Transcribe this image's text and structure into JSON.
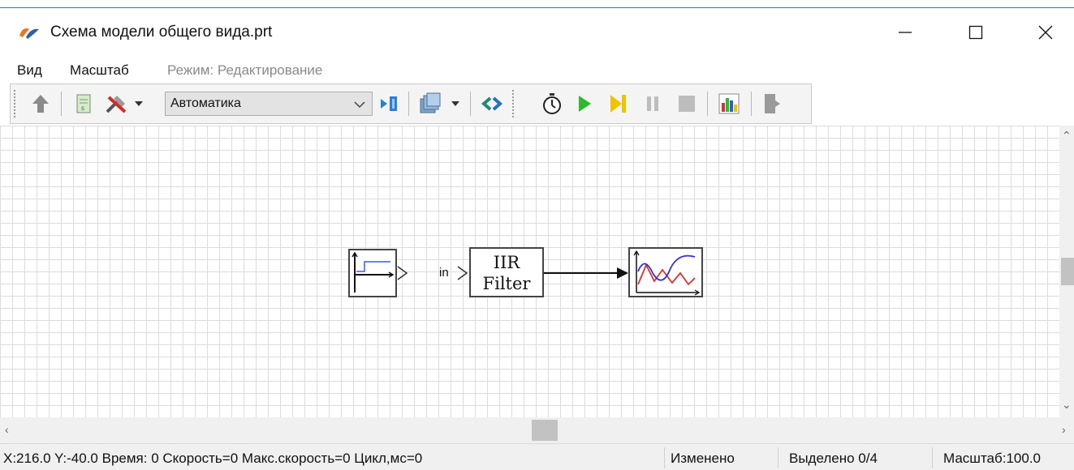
{
  "window": {
    "title": "Схема модели общего вида.prt",
    "icon": "app-logo-icon"
  },
  "menu": {
    "items": [
      "Вид",
      "Масштаб"
    ],
    "mode": "Режим: Редактирование"
  },
  "toolbar": {
    "library_select": "Автоматика",
    "icons": [
      "up-arrow-icon",
      "document-icon",
      "tools-icon",
      "dropdown-icon",
      "library-select",
      "insert-block-icon",
      "layers-icon",
      "dropdown-icon",
      "link-icon",
      "timer-icon",
      "play-icon",
      "step-icon",
      "pause-icon",
      "stop-icon",
      "chart-icon",
      "exit-icon"
    ]
  },
  "diagram": {
    "blocks": [
      {
        "name": "step-source-block",
        "type": "step"
      },
      {
        "name": "iir-filter-block",
        "label_line1": "IIR",
        "label_line2": "Filter",
        "input_port": "in"
      },
      {
        "name": "scope-block",
        "type": "plot"
      }
    ]
  },
  "status": {
    "coords": "X:216.0  Y:-40.0 Время: 0 Скорость=0 Макс.скорость=0 Цикл,мс=0",
    "modified": "Изменено",
    "selected": "Выделено 0/4",
    "scale": "Масштаб:100.0"
  },
  "colors": {
    "accent": "#3b73b9",
    "play": "#2dbb2d",
    "step": "#f2c200",
    "plot_red": "#e03030",
    "plot_blue": "#3030e0"
  }
}
